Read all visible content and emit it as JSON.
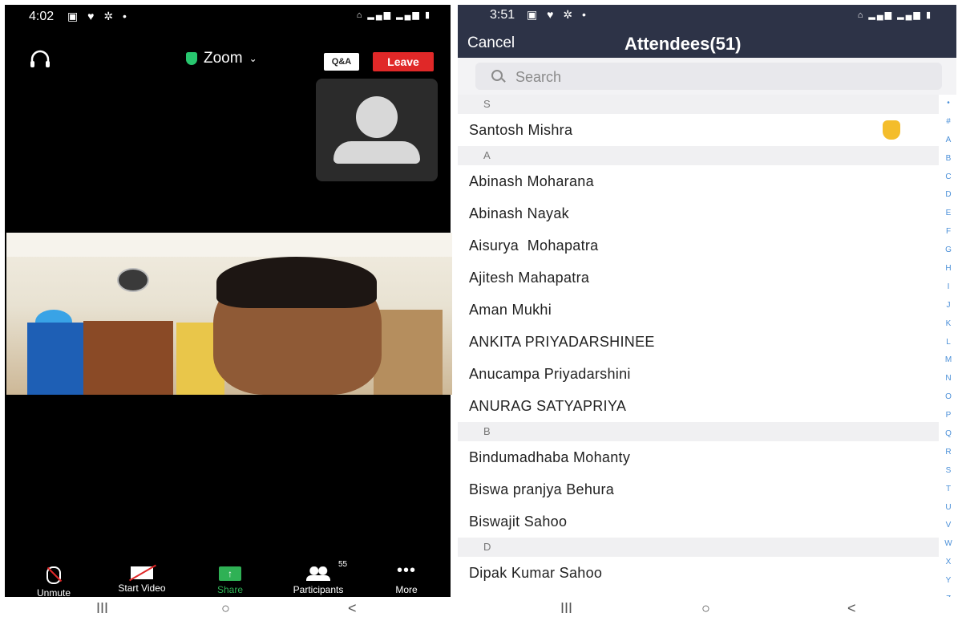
{
  "left": {
    "status": {
      "time": "4:02"
    },
    "top_bar": {
      "title": "Zoom",
      "qa_label": "Q&A",
      "leave_label": "Leave"
    },
    "toolbar": {
      "unmute": "Unmute",
      "start_video": "Start Video",
      "share": "Share",
      "participants": "Participants",
      "participants_count": "55",
      "more": "More"
    }
  },
  "right": {
    "status": {
      "time": "3:51"
    },
    "header": {
      "cancel": "Cancel",
      "title": "Attendees(51)"
    },
    "search": {
      "placeholder": "Search"
    },
    "sections": [
      {
        "letter": "S",
        "names": [
          "Santosh Mishra"
        ]
      },
      {
        "letter": "A",
        "names": [
          "Abinash Moharana",
          "Abinash Nayak",
          "Aisurya  Mohapatra",
          "Ajitesh Mahapatra",
          "Aman Mukhi",
          "ANKITA PRIYADARSHINEE",
          "Anucampa Priyadarshini",
          "ANURAG SATYAPRIYA"
        ]
      },
      {
        "letter": "B",
        "names": [
          "Bindumadhaba Mohanty",
          "Biswa pranjya Behura",
          "Biswajit Sahoo"
        ]
      },
      {
        "letter": "D",
        "names": [
          "Dipak Kumar Sahoo"
        ]
      }
    ],
    "index_letters": [
      "•",
      "#",
      "A",
      "B",
      "C",
      "D",
      "E",
      "F",
      "G",
      "H",
      "I",
      "J",
      "K",
      "L",
      "M",
      "N",
      "O",
      "P",
      "Q",
      "R",
      "S",
      "T",
      "U",
      "V",
      "W",
      "X",
      "Y",
      "Z"
    ]
  },
  "navbar": {
    "recents": "III",
    "home": "○",
    "back": "<"
  }
}
